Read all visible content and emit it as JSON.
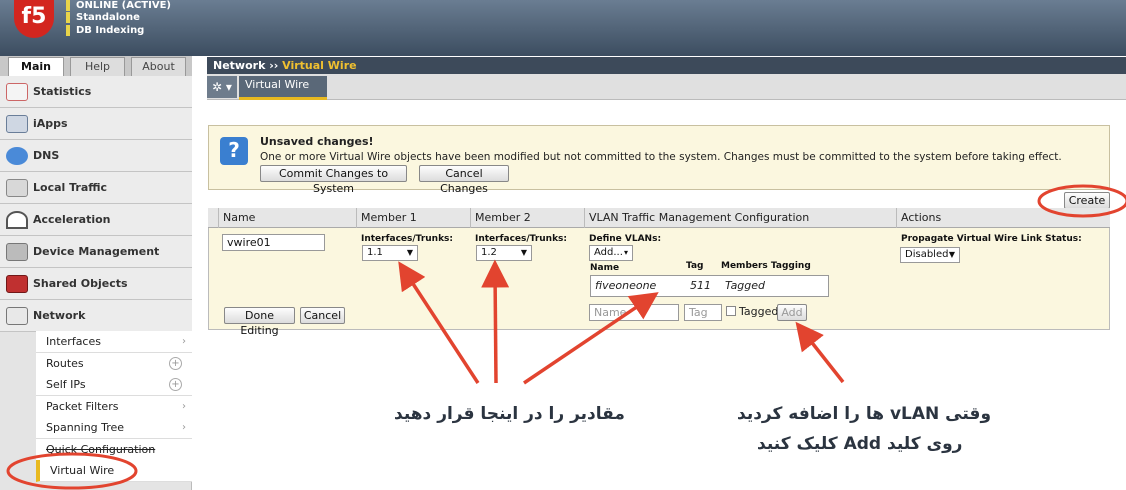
{
  "status": {
    "line1": "ONLINE (ACTIVE)",
    "line2": "Standalone",
    "line3": "DB Indexing"
  },
  "logo_text": "f5",
  "tabs": {
    "main": "Main",
    "help": "Help",
    "about": "About"
  },
  "sidebar": {
    "items": [
      "Statistics",
      "iApps",
      "DNS",
      "Local Traffic",
      "Acceleration",
      "Device Management",
      "Shared Objects",
      "Network"
    ],
    "network_sub": [
      "Interfaces",
      "Routes",
      "Self IPs",
      "Packet Filters",
      "Spanning Tree",
      "Quick Configuration",
      "Virtual Wire"
    ]
  },
  "breadcrumb": {
    "section": "Network",
    "sep": "››",
    "page": "Virtual Wire"
  },
  "subnav": {
    "gear": "✲ ▾",
    "tab": "Virtual Wire"
  },
  "message": {
    "title": "Unsaved changes!",
    "body": "One or more Virtual Wire objects have been modified but not committed to the system. Changes must be committed to the system before taking effect.",
    "commit": "Commit Changes to System",
    "cancel": "Cancel Changes"
  },
  "create_button": "Create",
  "table": {
    "headers": [
      "Name",
      "Member 1",
      "Member 2",
      "VLAN Traffic Management Configuration",
      "Actions"
    ],
    "name_value": "vwire01",
    "interfaces_label": "Interfaces/Trunks:",
    "member1": "1.1",
    "member2": "1.2",
    "define_vlans": "Define VLANs:",
    "add_select": "Add...",
    "vlan_cols": {
      "name": "Name",
      "tag": "Tag",
      "members": "Members Tagging"
    },
    "vlan_row": {
      "name": "fiveoneone",
      "tag": "511",
      "tagging": "Tagged"
    },
    "name_placeholder": "Name",
    "tag_placeholder": "Tag",
    "tagged_label": "Tagged",
    "add_button": "Add",
    "propagate_label": "Propagate Virtual Wire Link Status:",
    "propagate_value": "Disabled",
    "done_button": "Done Editing",
    "cancel_button": "Cancel"
  },
  "annotations": {
    "left": "مقادیر را در اینجا قرار دهید",
    "right_line1": "وقتی vLAN ها را اضافه کردید",
    "right_line2": "روی کلید Add کلیک کنید"
  },
  "colors": {
    "arrow": "#e2442f",
    "accent": "#e8b920",
    "header": "#3d4a5a"
  }
}
